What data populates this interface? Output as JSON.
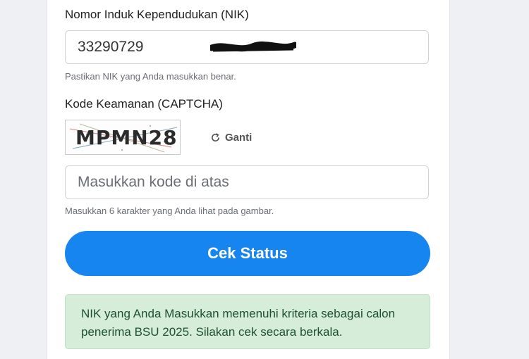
{
  "nik": {
    "label": "Nomor Induk Kependudukan (NIK)",
    "value": "33290729",
    "help": "Pastikan NIK yang Anda masukkan benar."
  },
  "captcha": {
    "label": "Kode Keamanan (CAPTCHA)",
    "code": "MPMN28",
    "refresh_label": "Ganti",
    "refresh_icon": "refresh-icon",
    "input_placeholder": "Masukkan kode di atas",
    "help": "Masukkan 6 karakter yang Anda lihat pada gambar."
  },
  "submit": {
    "label": "Cek Status",
    "color": "#1685ef"
  },
  "result": {
    "message": "NIK yang Anda Masukkan memenuhi kriteria sebagai calon penerima BSU 2025. Silakan cek secara berkala.",
    "color": "#d6eed9"
  }
}
